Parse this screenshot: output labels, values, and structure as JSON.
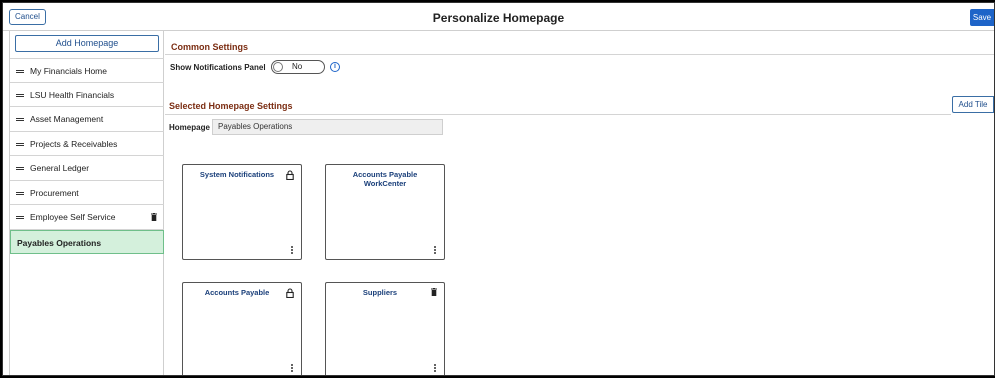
{
  "header": {
    "cancel_label": "Cancel",
    "title": "Personalize Homepage",
    "save_label": "Save"
  },
  "sidebar": {
    "add_homepage_label": "Add Homepage",
    "items": [
      {
        "label": "My Financials Home"
      },
      {
        "label": "LSU Health Financials"
      },
      {
        "label": "Asset Management"
      },
      {
        "label": "Projects & Receivables"
      },
      {
        "label": "General Ledger"
      },
      {
        "label": "Procurement"
      },
      {
        "label": "Employee Self Service",
        "icon": "trash-icon"
      },
      {
        "label": "Payables Operations",
        "selected": true
      }
    ]
  },
  "common_settings": {
    "title": "Common Settings",
    "show_notifications_label": "Show Notifications Panel",
    "toggle_value": "No",
    "info_icon": "info-icon"
  },
  "selected_settings": {
    "title": "Selected Homepage Settings",
    "add_tile_label": "Add Tile",
    "homepage_label": "Homepage",
    "homepage_value": "Payables Operations"
  },
  "tiles": [
    {
      "title": "System Notifications",
      "icon": "lock-icon"
    },
    {
      "title": "Accounts Payable WorkCenter",
      "icon": ""
    },
    {
      "title": "Accounts Payable",
      "icon": "lock-icon"
    },
    {
      "title": "Suppliers",
      "icon": "trash-icon"
    }
  ],
  "colors": {
    "accent": "#1e64c8",
    "section_title": "#7b2d12",
    "selected_bg": "#d4f0dc",
    "tile_title": "#1a3f7a"
  }
}
